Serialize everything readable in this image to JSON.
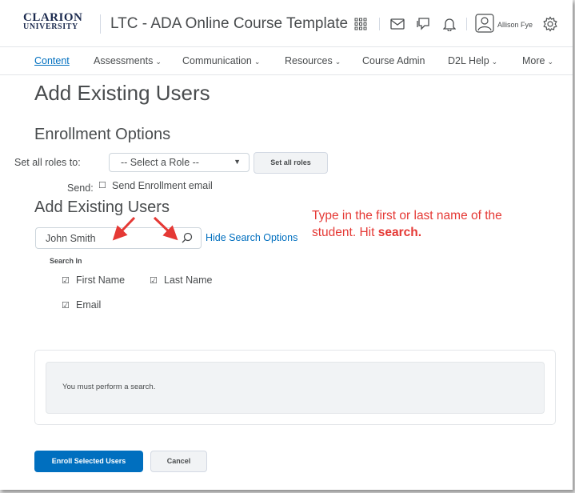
{
  "header": {
    "logo_line1": "CLARION",
    "logo_line2": "UNIVERSITY",
    "course_title": "LTC - ADA Online Course Template",
    "user_name": "Allison Fye",
    "icons": [
      "waffle-icon",
      "mail-icon",
      "chat-icon",
      "bell-icon",
      "user-avatar-icon",
      "gear-icon"
    ]
  },
  "nav": {
    "items": [
      {
        "label": "Content"
      },
      {
        "label": "Assessments"
      },
      {
        "label": "Communication"
      },
      {
        "label": "Resources"
      },
      {
        "label": "Course Admin"
      },
      {
        "label": "D2L Help"
      },
      {
        "label": "More"
      }
    ],
    "chevron": "⌄"
  },
  "page": {
    "title": "Add Existing Users",
    "enrollment_heading": "Enrollment Options",
    "set_roles_label": "Set all roles to:",
    "role_select_value": "-- Select a Role --",
    "set_all_roles_button": "Set all roles",
    "send_label": "Send:",
    "send_email_label": "Send Enrollment email",
    "add_users_heading": "Add Existing Users",
    "search_value": "John Smith",
    "hide_search_options": "Hide Search Options",
    "search_in_label": "Search In",
    "search_in_options": [
      "First Name",
      "Last Name",
      "Email"
    ],
    "checked_mark": "☑",
    "unchecked_mark": "☐",
    "results_message": "You must perform a search.",
    "enroll_button": "Enroll Selected Users",
    "cancel_button": "Cancel"
  },
  "annotation": {
    "line_text": "Type in the first or last name of the student. Hit",
    "bold_text": "search."
  },
  "colors": {
    "link": "#006fbf",
    "primary_button": "#006fbf",
    "annotation": "#e53935",
    "text": "#494c4e"
  }
}
